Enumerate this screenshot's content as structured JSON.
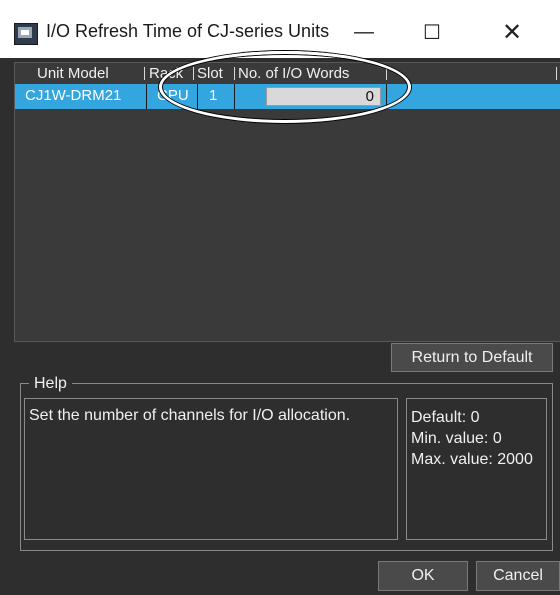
{
  "window": {
    "title": "I/O Refresh Time of CJ-series Units",
    "minimize_glyph": "—",
    "maximize_glyph": "☐",
    "close_glyph": "✕"
  },
  "grid": {
    "columns": [
      "Unit Model",
      "Rack",
      "Slot",
      "No. of I/O Words"
    ],
    "rows": [
      {
        "unit_model": "CJ1W-DRM21",
        "rack": "CPU",
        "slot": "1",
        "io_words": "0"
      }
    ],
    "selected_row_color": "#33a5df"
  },
  "buttons": {
    "return_to_default": "Return to Default",
    "ok": "OK",
    "cancel": "Cancel"
  },
  "help": {
    "legend": "Help",
    "description": "Set the number of channels for I/O allocation.",
    "default_label": "Default: 0",
    "min_label": "Min. value: 0",
    "max_label": "Max. value: 2000"
  }
}
